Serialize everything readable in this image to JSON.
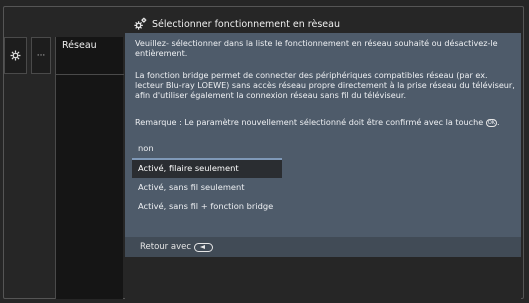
{
  "header": {
    "title": "Sélectionner fonctionnement en rèseau",
    "icon": "network-gear-icon"
  },
  "sidebar": {
    "gear_icon": "gear-icon",
    "dots": "···",
    "active_label": "Réseau"
  },
  "panel": {
    "para1": "Veuillez- sélectionner dans la liste le fonctionnement en réseau souhaité ou désactivez-le entièrement.",
    "para2": "La fonction bridge permet de connecter des périphériques compatibles réseau (par ex. lecteur Blu-ray LOEWE) sans accès réseau propre directement à la prise réseau du téléviseur, afin d'utiliser également la connexion réseau sans fil du téléviseur.",
    "para3_before": "Remarque : Le paramètre nouvellement sélectionné doit être confirmé avec la touche",
    "para3_after": ".",
    "ok_key": "OK"
  },
  "options": [
    {
      "label": "non",
      "selected": false
    },
    {
      "label": "Activé, filaire seulement",
      "selected": true
    },
    {
      "label": "Activé, sans fil seulement",
      "selected": false
    },
    {
      "label": "Activé, sans fil + fonction bridge",
      "selected": false
    }
  ],
  "footer": {
    "back_label": "Retour avec",
    "back_icon": "back-key-icon"
  },
  "colors": {
    "panel_bg": "#4e5b6a",
    "selected_bg": "#2a2d31",
    "selected_accent": "#7f99b8",
    "footer_bg": "#414b56"
  }
}
